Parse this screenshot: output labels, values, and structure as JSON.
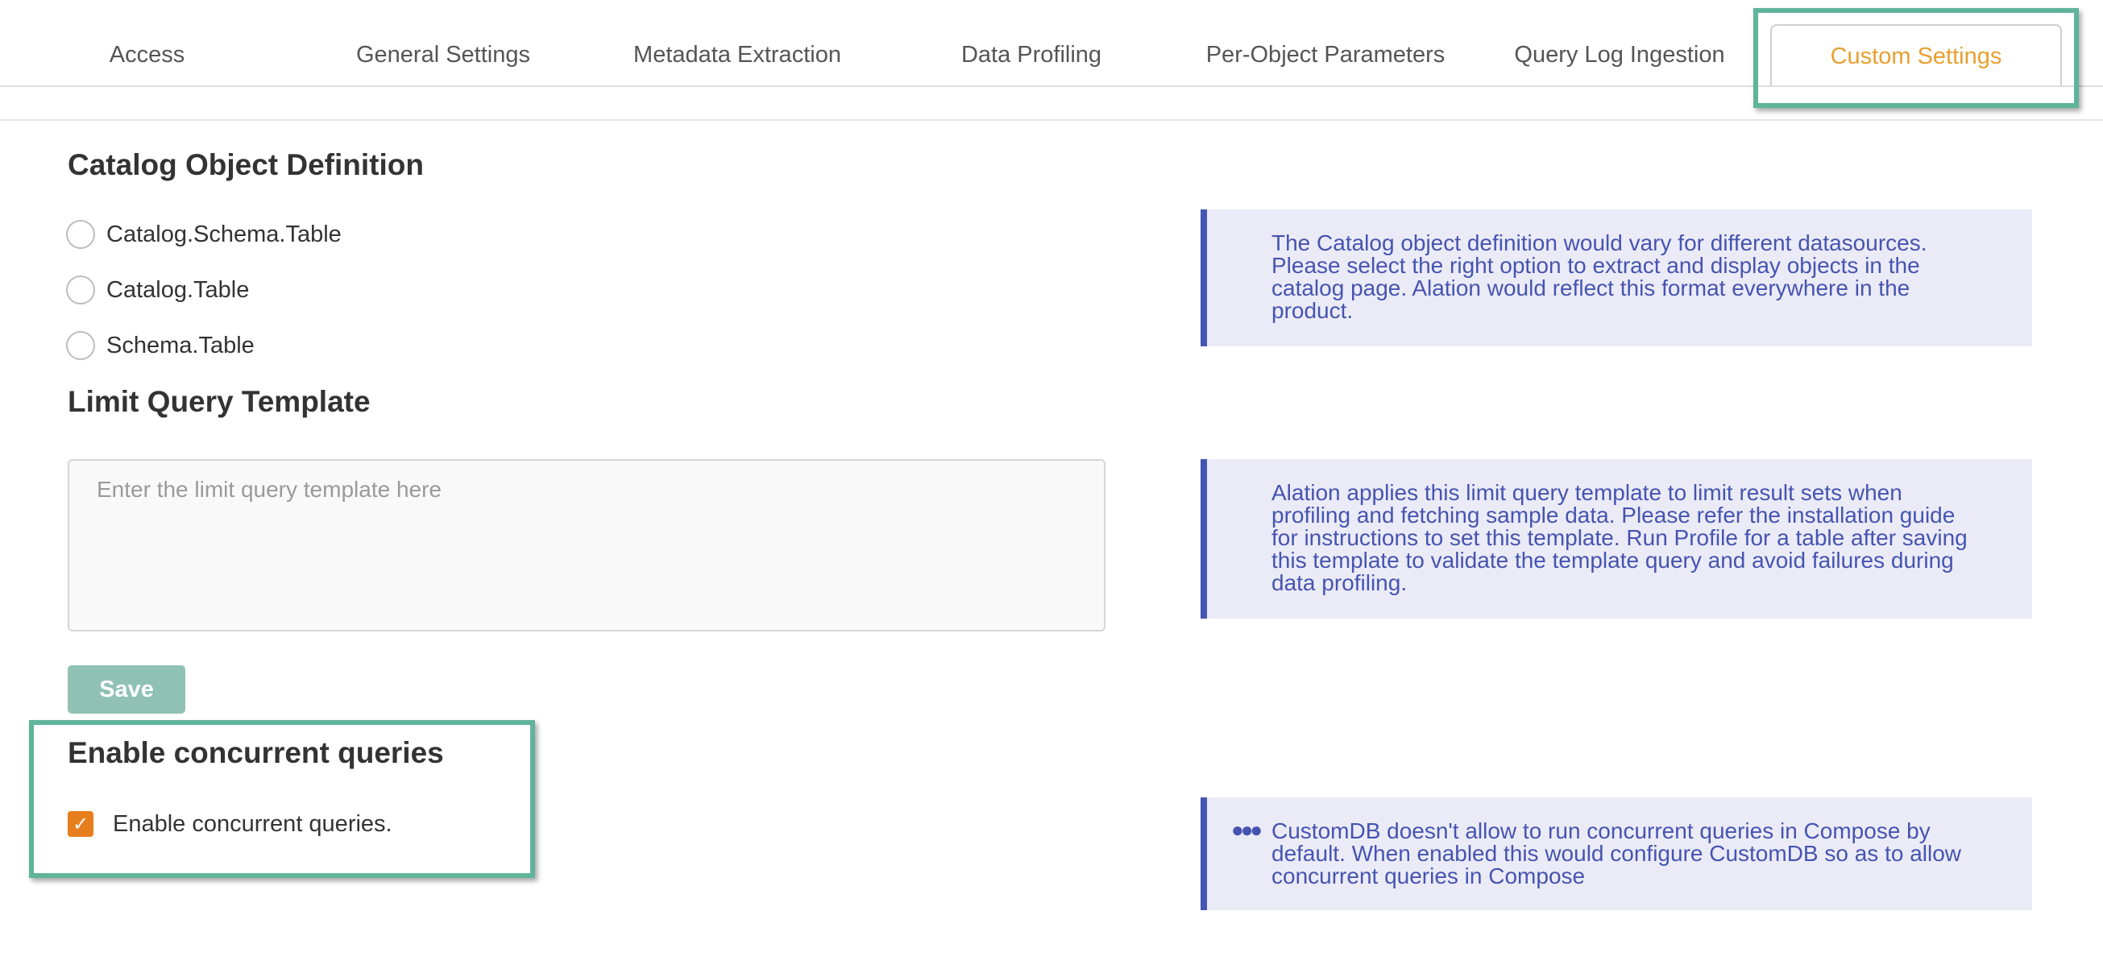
{
  "tabs": [
    {
      "label": "Access",
      "active": false
    },
    {
      "label": "General Settings",
      "active": false
    },
    {
      "label": "Metadata Extraction",
      "active": false
    },
    {
      "label": "Data Profiling",
      "active": false
    },
    {
      "label": "Per-Object Parameters",
      "active": false
    },
    {
      "label": "Query Log Ingestion",
      "active": false
    },
    {
      "label": "Custom Settings",
      "active": true
    }
  ],
  "catalog_object_definition": {
    "title": "Catalog Object Definition",
    "options": [
      "Catalog.Schema.Table",
      "Catalog.Table",
      "Schema.Table"
    ],
    "selected": null,
    "info": "The Catalog object definition would vary for different datasources. Please select the right option to extract and display objects in the catalog page. Alation would reflect this format everywhere in the product."
  },
  "limit_query_template": {
    "title": "Limit Query Template",
    "value": "",
    "placeholder": "Enter the limit query template here",
    "save_label": "Save",
    "info": "Alation applies this limit query template to limit result sets when profiling and fetching sample data. Please refer the installation guide for instructions to set this template. Run Profile for a table after saving this template to validate the template query and avoid failures during data profiling."
  },
  "concurrent_queries": {
    "title": "Enable concurrent queries",
    "checkbox_label": "Enable concurrent queries.",
    "checked": true,
    "info_icon": "ellipsis-icon",
    "info": "CustomDB doesn't allow to run concurrent queries in Compose by default. When enabled this would configure CustomDB so as to allow concurrent queries in Compose"
  },
  "colors": {
    "accent_tab": "#e8a030",
    "highlight": "#5fb49a",
    "info_text": "#4654b0",
    "checkbox": "#e67e1e",
    "save_button": "#8fc1b4"
  }
}
